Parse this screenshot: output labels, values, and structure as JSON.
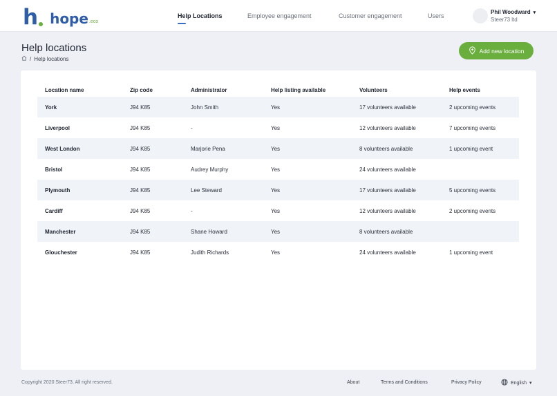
{
  "brand": {
    "name": "hope",
    "suffix": ".eco",
    "primary_color": "#2f5da8",
    "accent_color": "#6aae3d"
  },
  "nav": {
    "items": [
      {
        "label": "Help Locations",
        "active": true
      },
      {
        "label": "Employee engagement",
        "active": false
      },
      {
        "label": "Customer engagement",
        "active": false
      },
      {
        "label": "Users",
        "active": false
      }
    ]
  },
  "user": {
    "name": "Phil Woodward",
    "org": "Steer73 ltd",
    "caret": "▾"
  },
  "page": {
    "title": "Help locations",
    "breadcrumb": {
      "home_icon": "home-icon",
      "separator": "/",
      "current": "Help locations"
    },
    "add_button": {
      "label": "Add new location",
      "icon": "location-plus-icon"
    }
  },
  "table": {
    "headers": [
      "Location name",
      "Zip code",
      "Administrator",
      "Help listing available",
      "Volunteers",
      "Help events"
    ],
    "rows": [
      [
        "York",
        "J94 K85",
        "John Smith",
        "Yes",
        "17 volunteers available",
        "2 upcoming events"
      ],
      [
        "Liverpool",
        "J94 K85",
        "-",
        "Yes",
        "12 volunteers available",
        "7 upcoming events"
      ],
      [
        "West London",
        "J94 K85",
        "Marjorie Pena",
        "Yes",
        "8 volunteers available",
        "1 upcoming event"
      ],
      [
        "Bristol",
        "J94 K85",
        "Audrey Murphy",
        "Yes",
        "24 volunteers available",
        ""
      ],
      [
        "Plymouth",
        "J94 K85",
        "Lee Steward",
        "Yes",
        "17 volunteers available",
        "5 upcoming events"
      ],
      [
        "Cardiff",
        "J94 K85",
        "-",
        "Yes",
        "12 volunteers available",
        "2 upcoming events"
      ],
      [
        "Manchester",
        "J94 K85",
        "Shane Howard",
        "Yes",
        "8 volunteers available",
        ""
      ],
      [
        "Glouchester",
        "J94 K85",
        "Judith Richards",
        "Yes",
        "24 volunteers available",
        "1 upcoming event"
      ]
    ]
  },
  "footer": {
    "copyright": "Copyright 2020 Steer73. All right reserved.",
    "links": [
      "About",
      "Terms and Conditions",
      "Privacy Policy"
    ],
    "language": "English",
    "language_caret": "▾",
    "language_icon": "globe-icon"
  }
}
